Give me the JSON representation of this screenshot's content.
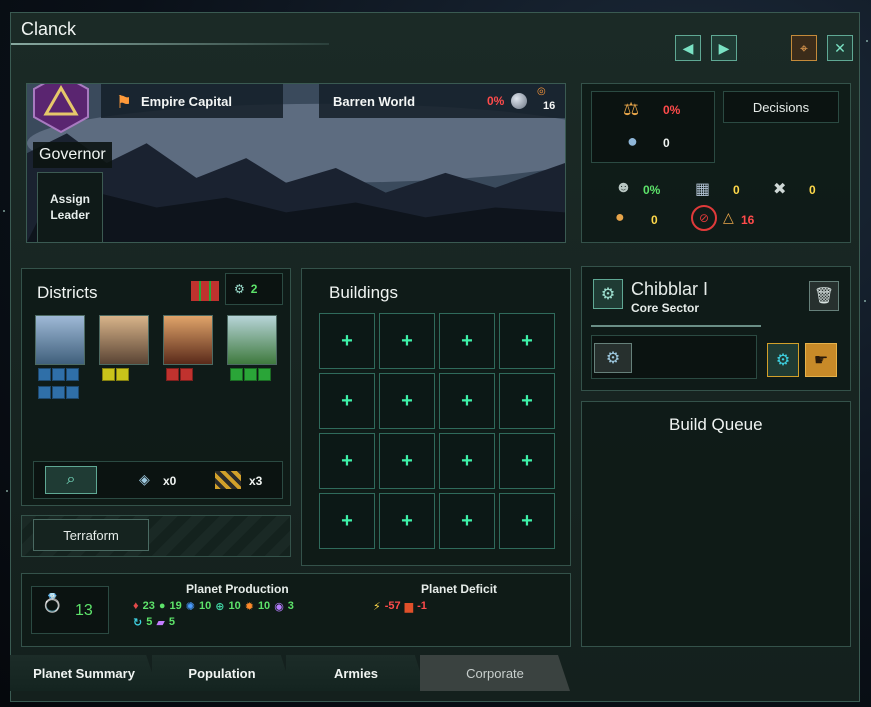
{
  "window": {
    "title": "Clanck"
  },
  "header": {
    "capital_label": "Empire Capital",
    "world_type": "Barren World",
    "habitability": "0%",
    "pop_capacity": "16",
    "governor_label": "Governor",
    "assign_leader": "Assign Leader"
  },
  "stats": {
    "stability": "0%",
    "pops": "0",
    "decisions_label": "Decisions",
    "crime": "0%",
    "amenities": "0",
    "housing": "0",
    "unemployed": "0",
    "free_jobs": "16"
  },
  "districts": {
    "title": "Districts",
    "slots": "2",
    "features_blocker": "x0",
    "features_hazard": "x3",
    "terraform_label": "Terraform",
    "colors": [
      "#2f6fa8",
      "#c9c41a",
      "#c0322e",
      "#2aa538"
    ],
    "counts": [
      6,
      2,
      2,
      3
    ]
  },
  "buildings": {
    "title": "Buildings",
    "cell_symbol": "+"
  },
  "sector": {
    "name": "Chibblar I",
    "subtitle": "Core Sector"
  },
  "build_queue": {
    "title": "Build Queue"
  },
  "production": {
    "pop_count": "13",
    "title": "Planet Production",
    "deficit_title": "Planet Deficit",
    "items": [
      {
        "icon": "unity-icon",
        "value": "23",
        "color": "#e24a4a"
      },
      {
        "icon": "food-icon",
        "value": "19",
        "color": "#5de36a"
      },
      {
        "icon": "research-icon",
        "value": "10",
        "color": "#4a9cff"
      },
      {
        "icon": "society-icon",
        "value": "10",
        "color": "#3fd0a0"
      },
      {
        "icon": "engineering-icon",
        "value": "10",
        "color": "#ff8a2a"
      },
      {
        "icon": "influence-icon",
        "value": "3",
        "color": "#b67dff"
      },
      {
        "icon": "trade-icon",
        "value": "5",
        "color": "#3fd0e0"
      },
      {
        "icon": "alloy-icon",
        "value": "5",
        "color": "#c47cff"
      }
    ],
    "deficit": [
      {
        "icon": "energy-icon",
        "value": "-57"
      },
      {
        "icon": "minerals-icon",
        "value": "-1"
      }
    ]
  },
  "tabs": [
    "Planet Summary",
    "Population",
    "Armies",
    "Corporate"
  ]
}
